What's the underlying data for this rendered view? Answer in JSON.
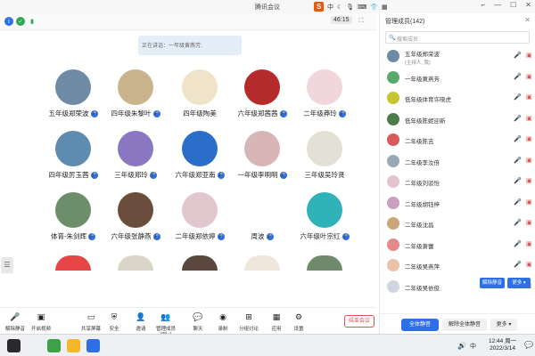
{
  "window": {
    "title": "腾讯会议",
    "ime": {
      "logo": "S",
      "lang": "中"
    },
    "controls": [
      "⌐",
      "—",
      "☐",
      "✕"
    ]
  },
  "meeting_bar": {
    "timer": "46:15"
  },
  "speaker": {
    "text": "正在讲话：一年级黄燕芳;"
  },
  "participants_grid": [
    {
      "name": "五年级郑荣波",
      "color": "#6e8aa5",
      "badge": true
    },
    {
      "name": "四年级朱黎叶",
      "color": "#c9b38c",
      "badge": true
    },
    {
      "name": "四年级陶美",
      "color": "#efe4c9",
      "badge": false
    },
    {
      "name": "六年级郑茜茜",
      "color": "#b52a2a",
      "badge": true
    },
    {
      "name": "二年级莽玲",
      "color": "#f1d6dc",
      "badge": true
    },
    {
      "name": "四年级厉玉茜",
      "color": "#5e8bb0",
      "badge": true
    },
    {
      "name": "三年级郑玲",
      "color": "#8a77c2",
      "badge": true
    },
    {
      "name": "六年级郑亚南",
      "color": "#2a6ec9",
      "badge": true
    },
    {
      "name": "一年级李明明",
      "color": "#d8b6b8",
      "badge": true
    },
    {
      "name": "三年级吴玲贤",
      "color": "#e3e0d5",
      "badge": false
    },
    {
      "name": "体育-朱剑辉",
      "color": "#6c8f6a",
      "badge": true
    },
    {
      "name": "六年级张静燕",
      "color": "#6a4d3c",
      "badge": true
    },
    {
      "name": "二年级郑依婷",
      "color": "#e3c7cf",
      "badge": true
    },
    {
      "name": "周波",
      "color": "#ffffff",
      "badge": true
    },
    {
      "name": "六年级叶宗红",
      "color": "#2fb2b8",
      "badge": true
    },
    {
      "name": "",
      "color": "#e64646",
      "badge": false
    },
    {
      "name": "",
      "color": "#d9d4c8",
      "badge": false
    },
    {
      "name": "",
      "color": "#5a4740",
      "badge": false
    },
    {
      "name": "",
      "color": "#efe6dc",
      "badge": false
    },
    {
      "name": "",
      "color": "#6f8b6c",
      "badge": false
    }
  ],
  "side_handle": {
    "icon": "☰"
  },
  "bottom_toolbar": {
    "items": [
      {
        "label": "解除静音",
        "glyph": "🎤"
      },
      {
        "label": "开启视频",
        "glyph": "▣"
      },
      {
        "label": "共享屏幕",
        "glyph": "▭"
      },
      {
        "label": "安全",
        "glyph": "⛨"
      },
      {
        "label": "邀请",
        "glyph": "👤"
      },
      {
        "label": "管理成员(99+)",
        "glyph": "👥"
      },
      {
        "label": "聊天",
        "glyph": "💬"
      },
      {
        "label": "录制",
        "glyph": "◉"
      },
      {
        "label": "分组讨论",
        "glyph": "⊞"
      },
      {
        "label": "应用",
        "glyph": "▦"
      },
      {
        "label": "设置",
        "glyph": "⚙"
      }
    ],
    "end_label": "结束会议"
  },
  "panel": {
    "title": "管理成员(142)",
    "search_placeholder": "搜索成员",
    "members": [
      {
        "name": "五年级郑荣波",
        "sub": "(主持人, 我)",
        "color": "#6e8aa5",
        "mic_on": false
      },
      {
        "name": "一年级黄燕芳",
        "sub": "",
        "color": "#5aa86c",
        "mic_on": true
      },
      {
        "name": "低年级体育许晓虎",
        "sub": "",
        "color": "#c7c430",
        "mic_on": false
      },
      {
        "name": "低年级陈妮迎新",
        "sub": "",
        "color": "#4d7c4c",
        "mic_on": false
      },
      {
        "name": "二年级陈吉",
        "sub": "",
        "color": "#d95a5a",
        "mic_on": false
      },
      {
        "name": "二年级李汝倍",
        "sub": "",
        "color": "#9aa8b5",
        "mic_on": false
      },
      {
        "name": "二年级刘驳怡",
        "sub": "",
        "color": "#e2c4cc",
        "mic_on": false
      },
      {
        "name": "二年级胡钰梓",
        "sub": "",
        "color": "#c9a0c0",
        "mic_on": false
      },
      {
        "name": "二年级沈昌",
        "sub": "",
        "color": "#caa67a",
        "mic_on": false
      },
      {
        "name": "二年级萧蕾",
        "sub": "",
        "color": "#e28a8a",
        "mic_on": false
      },
      {
        "name": "二年级吴燕萍",
        "sub": "",
        "color": "#e9c2a8",
        "mic_on": false
      },
      {
        "name": "二年级吴依俊",
        "sub": "",
        "color": "#d0d6e0",
        "mic_on": false
      }
    ],
    "inline_buttons": [
      "解除静音",
      "更多 ▾"
    ],
    "footer": {
      "mute_all": "全体静音",
      "unmute_all": "解除全体静音",
      "more": "更多 ▾"
    }
  },
  "taskbar": {
    "time": "12:44 周一",
    "date": "2022/3/14"
  }
}
